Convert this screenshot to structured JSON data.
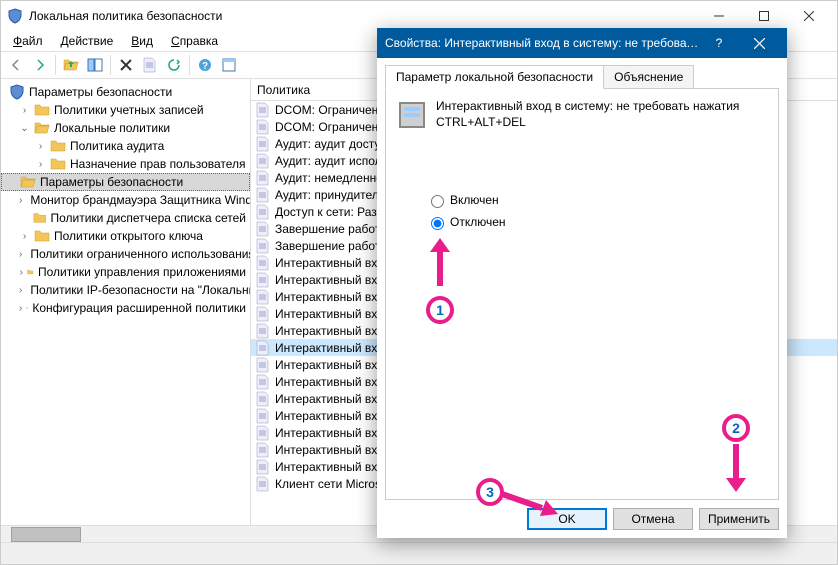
{
  "window": {
    "title": "Локальная политика безопасности"
  },
  "menu": {
    "file": "Файл",
    "action": "Действие",
    "view": "Вид",
    "help": "Справка"
  },
  "tree": {
    "root": "Параметры безопасности",
    "items": [
      "Политики учетных записей",
      "Локальные политики",
      "Монитор брандмауэра Защитника Windows",
      "Политики диспетчера списка сетей",
      "Политики открытого ключа",
      "Политики ограниченного использования",
      "Политики управления приложениями",
      "Политики IP-безопасности на \"Локальный компьютер\"",
      "Конфигурация расширенной политики"
    ],
    "local_children": [
      "Политика аудита",
      "Назначение прав пользователя",
      "Параметры безопасности"
    ]
  },
  "list": {
    "header": "Политика",
    "rows": [
      "DCOM: Ограничения",
      "DCOM: Ограничения",
      "Аудит: аудит доступа",
      "Аудит: аудит использования",
      "Аудит: немедленное",
      "Аудит: принудительно",
      "Доступ к сети: Разрешить",
      "Завершение работы",
      "Завершение работы",
      "Интерактивный вход",
      "Интерактивный вход",
      "Интерактивный вход",
      "Интерактивный вход",
      "Интерактивный вход",
      "Интерактивный вход",
      "Интерактивный вход",
      "Интерактивный вход",
      "Интерактивный вход",
      "Интерактивный вход",
      "Интерактивный вход",
      "Интерактивный вход",
      "Интерактивный вход",
      "Клиент сети Microsoft"
    ],
    "selected_index": 14
  },
  "dialog": {
    "title": "Свойства: Интерактивный вход в систему: не требоват...",
    "tab1": "Параметр локальной безопасности",
    "tab2": "Объяснение",
    "policy_text": "Интерактивный вход в систему: не требовать нажатия CTRL+ALT+DEL",
    "radio_enabled": "Включен",
    "radio_disabled": "Отключен",
    "btn_ok": "OK",
    "btn_cancel": "Отмена",
    "btn_apply": "Применить"
  },
  "annotations": {
    "n1": "1",
    "n2": "2",
    "n3": "3"
  }
}
